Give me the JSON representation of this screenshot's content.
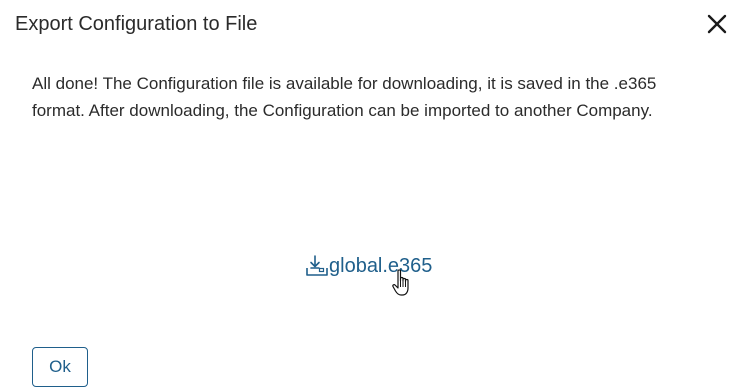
{
  "dialog": {
    "title": "Export Configuration to File",
    "message": "All done! The Configuration file is available for downloading, it is saved in the .e365 format. After downloading, the Configuration can be imported to another Company.",
    "download": {
      "file_name": "global.e365",
      "icon": "download-icon"
    },
    "ok_label": "Ok",
    "close_icon": "close-icon"
  },
  "colors": {
    "link": "#1f5f8b",
    "text": "#2b2b2b",
    "button_border": "#1f5f8b"
  }
}
